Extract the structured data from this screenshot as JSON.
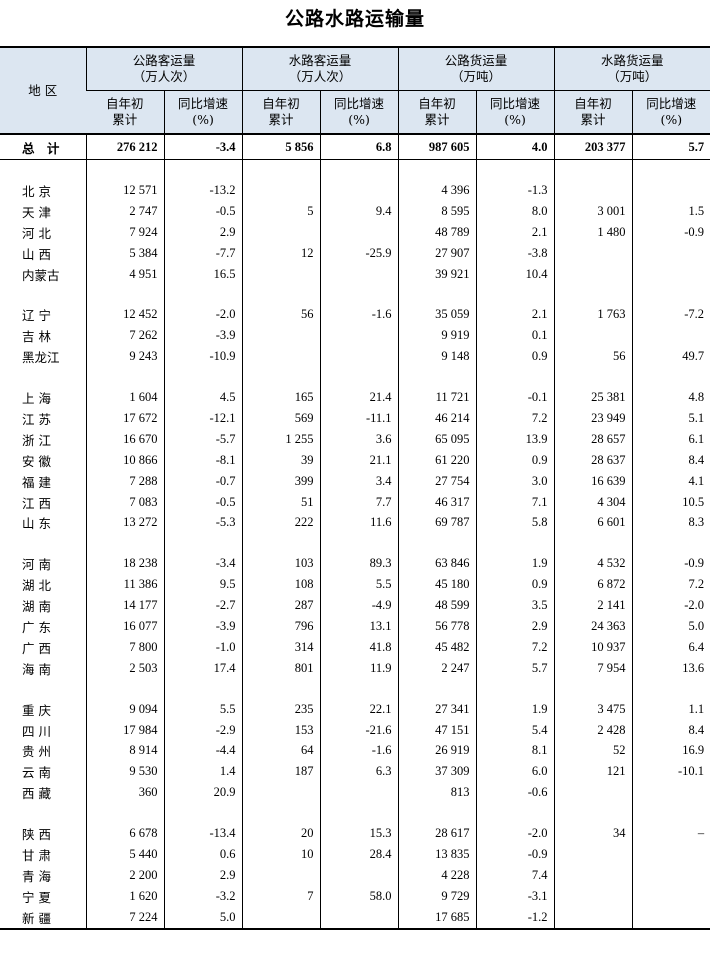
{
  "title": "公路水路运输量",
  "header": {
    "region": "地  区",
    "groups": [
      {
        "name": "公路客运量",
        "unit": "（万人次）"
      },
      {
        "name": "水路客运量",
        "unit": "（万人次）"
      },
      {
        "name": "公路货运量",
        "unit": "（万吨）"
      },
      {
        "name": "水路货运量",
        "unit": "（万吨）"
      }
    ],
    "sub_cum_1": "自年初",
    "sub_cum_2": "累计",
    "sub_rate_1": "同比增速",
    "sub_rate_2": "(%)"
  },
  "total": {
    "region": "总  计",
    "v": [
      "276 212",
      "-3.4",
      "5 856",
      "6.8",
      "987 605",
      "4.0",
      "203 377",
      "5.7"
    ]
  },
  "groups": [
    [
      {
        "region": "北  京",
        "v": [
          "12 571",
          "-13.2",
          "",
          "",
          "4 396",
          "-1.3",
          "",
          ""
        ]
      },
      {
        "region": "天  津",
        "v": [
          "2 747",
          "-0.5",
          "5",
          "9.4",
          "8 595",
          "8.0",
          "3 001",
          "1.5"
        ]
      },
      {
        "region": "河  北",
        "v": [
          "7 924",
          "2.9",
          "",
          "",
          "48 789",
          "2.1",
          "1 480",
          "-0.9"
        ]
      },
      {
        "region": "山  西",
        "v": [
          "5 384",
          "-7.7",
          "12",
          "-25.9",
          "27 907",
          "-3.8",
          "",
          ""
        ]
      },
      {
        "region": "内蒙古",
        "v": [
          "4 951",
          "16.5",
          "",
          "",
          "39 921",
          "10.4",
          "",
          ""
        ]
      }
    ],
    [
      {
        "region": "辽  宁",
        "v": [
          "12 452",
          "-2.0",
          "56",
          "-1.6",
          "35 059",
          "2.1",
          "1 763",
          "-7.2"
        ]
      },
      {
        "region": "吉  林",
        "v": [
          "7 262",
          "-3.9",
          "",
          "",
          "9 919",
          "0.1",
          "",
          ""
        ]
      },
      {
        "region": "黑龙江",
        "v": [
          "9 243",
          "-10.9",
          "",
          "",
          "9 148",
          "0.9",
          "56",
          "49.7"
        ]
      }
    ],
    [
      {
        "region": "上  海",
        "v": [
          "1 604",
          "4.5",
          "165",
          "21.4",
          "11 721",
          "-0.1",
          "25 381",
          "4.8"
        ]
      },
      {
        "region": "江  苏",
        "v": [
          "17 672",
          "-12.1",
          "569",
          "-11.1",
          "46 214",
          "7.2",
          "23 949",
          "5.1"
        ]
      },
      {
        "region": "浙  江",
        "v": [
          "16 670",
          "-5.7",
          "1 255",
          "3.6",
          "65 095",
          "13.9",
          "28 657",
          "6.1"
        ]
      },
      {
        "region": "安  徽",
        "v": [
          "10 866",
          "-8.1",
          "39",
          "21.1",
          "61 220",
          "0.9",
          "28 637",
          "8.4"
        ]
      },
      {
        "region": "福  建",
        "v": [
          "7 288",
          "-0.7",
          "399",
          "3.4",
          "27 754",
          "3.0",
          "16 639",
          "4.1"
        ]
      },
      {
        "region": "江  西",
        "v": [
          "7 083",
          "-0.5",
          "51",
          "7.7",
          "46 317",
          "7.1",
          "4 304",
          "10.5"
        ]
      },
      {
        "region": "山  东",
        "v": [
          "13 272",
          "-5.3",
          "222",
          "11.6",
          "69 787",
          "5.8",
          "6 601",
          "8.3"
        ]
      }
    ],
    [
      {
        "region": "河  南",
        "v": [
          "18 238",
          "-3.4",
          "103",
          "89.3",
          "63 846",
          "1.9",
          "4 532",
          "-0.9"
        ]
      },
      {
        "region": "湖  北",
        "v": [
          "11 386",
          "9.5",
          "108",
          "5.5",
          "45 180",
          "0.9",
          "6 872",
          "7.2"
        ]
      },
      {
        "region": "湖  南",
        "v": [
          "14 177",
          "-2.7",
          "287",
          "-4.9",
          "48 599",
          "3.5",
          "2 141",
          "-2.0"
        ]
      },
      {
        "region": "广  东",
        "v": [
          "16 077",
          "-3.9",
          "796",
          "13.1",
          "56 778",
          "2.9",
          "24 363",
          "5.0"
        ]
      },
      {
        "region": "广  西",
        "v": [
          "7 800",
          "-1.0",
          "314",
          "41.8",
          "45 482",
          "7.2",
          "10 937",
          "6.4"
        ]
      },
      {
        "region": "海  南",
        "v": [
          "2 503",
          "17.4",
          "801",
          "11.9",
          "2 247",
          "5.7",
          "7 954",
          "13.6"
        ]
      }
    ],
    [
      {
        "region": "重  庆",
        "v": [
          "9 094",
          "5.5",
          "235",
          "22.1",
          "27 341",
          "1.9",
          "3 475",
          "1.1"
        ]
      },
      {
        "region": "四  川",
        "v": [
          "17 984",
          "-2.9",
          "153",
          "-21.6",
          "47 151",
          "5.4",
          "2 428",
          "8.4"
        ]
      },
      {
        "region": "贵  州",
        "v": [
          "8 914",
          "-4.4",
          "64",
          "-1.6",
          "26 919",
          "8.1",
          "52",
          "16.9"
        ]
      },
      {
        "region": "云  南",
        "v": [
          "9 530",
          "1.4",
          "187",
          "6.3",
          "37 309",
          "6.0",
          "121",
          "-10.1"
        ]
      },
      {
        "region": "西  藏",
        "v": [
          "360",
          "20.9",
          "",
          "",
          "813",
          "-0.6",
          "",
          ""
        ]
      }
    ],
    [
      {
        "region": "陕  西",
        "v": [
          "6 678",
          "-13.4",
          "20",
          "15.3",
          "28 617",
          "-2.0",
          "34",
          "–"
        ]
      },
      {
        "region": "甘  肃",
        "v": [
          "5 440",
          "0.6",
          "10",
          "28.4",
          "13 835",
          "-0.9",
          "",
          ""
        ]
      },
      {
        "region": "青  海",
        "v": [
          "2 200",
          "2.9",
          "",
          "",
          "4 228",
          "7.4",
          "",
          ""
        ]
      },
      {
        "region": "宁  夏",
        "v": [
          "1 620",
          "-3.2",
          "7",
          "58.0",
          "9 729",
          "-3.1",
          "",
          ""
        ]
      },
      {
        "region": "新  疆",
        "v": [
          "7 224",
          "5.0",
          "",
          "",
          "17 685",
          "-1.2",
          "",
          ""
        ]
      }
    ]
  ]
}
